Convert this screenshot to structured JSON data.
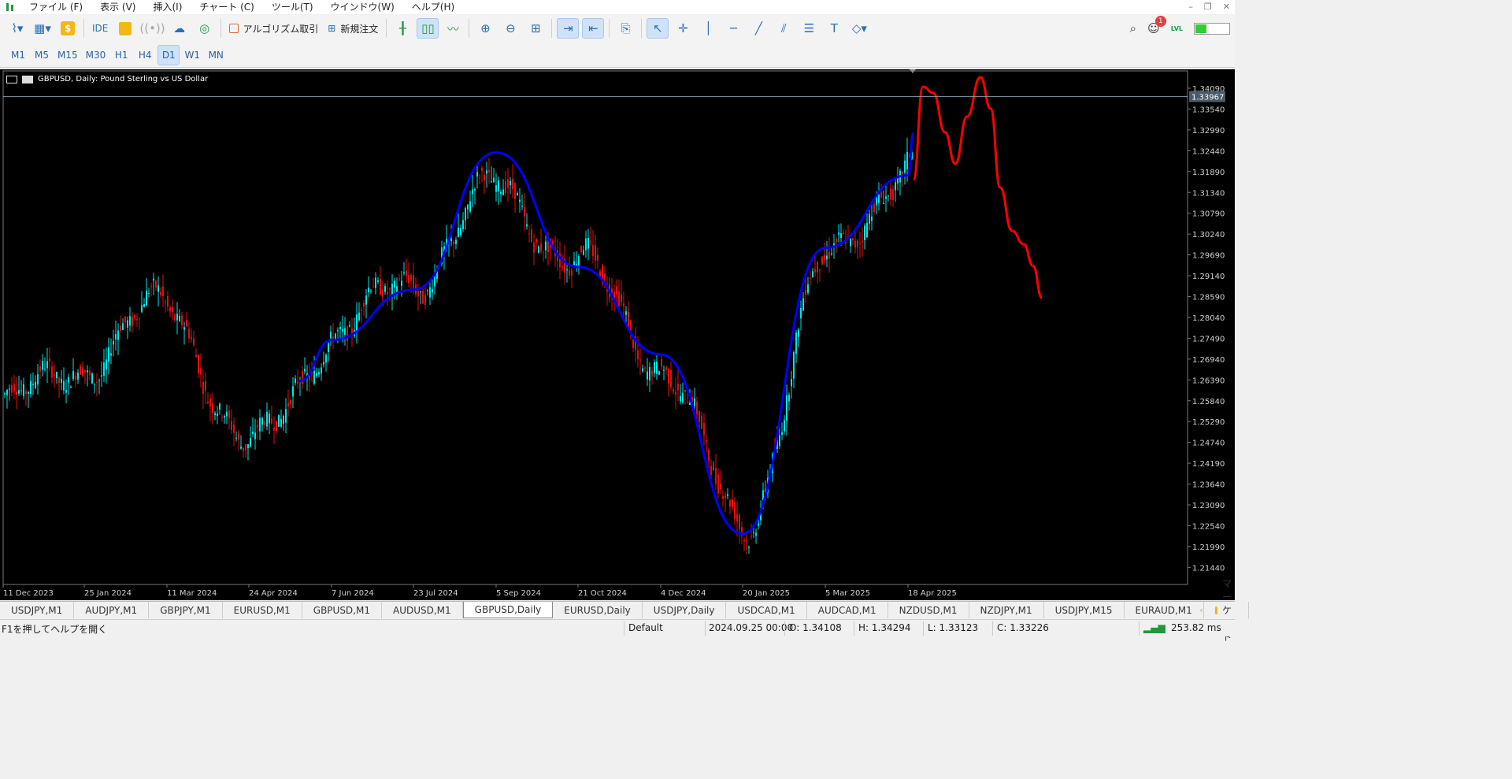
{
  "menu": [
    "ファイル (F)",
    "表示 (V)",
    "挿入(I)",
    "チャート (C)",
    "ツール(T)",
    "ウインドウ(W)",
    "ヘルプ(H)"
  ],
  "toolbar": {
    "ide_label": "IDE",
    "algo_label": "アルゴリズム取引",
    "new_order_label": "新規注文",
    "notifications_count": "1",
    "lvl_label": "LVL"
  },
  "timeframes": [
    "M1",
    "M5",
    "M15",
    "M30",
    "H1",
    "H4",
    "D1",
    "W1",
    "MN"
  ],
  "active_timeframe": "D1",
  "chart": {
    "title": "GBPUSD, Daily:  Pound Sterling vs US Dollar",
    "current_price": "1.33967",
    "price_labels": [
      "1.34090",
      "1.33540",
      "1.32990",
      "1.32440",
      "1.31890",
      "1.31340",
      "1.30790",
      "1.30240",
      "1.29690",
      "1.29140",
      "1.28590",
      "1.28040",
      "1.27490",
      "1.26940",
      "1.26390",
      "1.25840",
      "1.25290",
      "1.24740",
      "1.24190",
      "1.23640",
      "1.23090",
      "1.22540",
      "1.21990",
      "1.21440"
    ],
    "date_labels": [
      "11 Dec 2023",
      "25 Jan 2024",
      "11 Mar 2024",
      "24 Apr 2024",
      "7 Jun 2024",
      "23 Jul 2024",
      "5 Sep 2024",
      "21 Oct 2024",
      "4 Dec 2024",
      "20 Jan 2025",
      "5 Mar 2025",
      "18 Apr 2025"
    ],
    "colors": {
      "bull": "#00e5e5",
      "bear": "#e01010",
      "ma": "#0000ff",
      "forecast": "#ff0000",
      "bg": "#000000"
    }
  },
  "chart_data": {
    "type": "line",
    "title": "GBPUSD, Daily:  Pound Sterling vs US Dollar",
    "ylim": [
      1.2117,
      1.3464
    ],
    "series": [
      {
        "x": [
          "11 Dec 2023",
          "25 Jan 2024",
          "11 Mar 2024",
          "24 Apr 2024",
          "7 Jun 2024",
          "23 Jul 2024",
          "5 Sep 2024",
          "21 Oct 2024",
          "4 Dec 2024",
          "20 Jan 2025",
          "5 Mar 2025",
          "18 Apr 2025"
        ],
        "values": [
          1.2587,
          1.2696,
          1.2855,
          1.2465,
          1.2763,
          1.2921,
          1.3155,
          1.296,
          1.2702,
          1.2261,
          1.2952,
          1.3225
        ]
      },
      {
        "x": [
          "7 Jun 2024",
          "23 Jul 2024",
          "5 Sep 2024",
          "21 Oct 2024",
          "4 Dec 2024",
          "20 Jan 2025",
          "5 Mar 2025",
          "18 Apr 2025"
        ],
        "values": [
          1.2758,
          1.289,
          1.325,
          1.295,
          1.272,
          1.225,
          1.3,
          1.319
        ]
      },
      {
        "x": [
          "18 Apr 2025"
        ],
        "values": [
          1.3397
        ]
      }
    ],
    "grid": false
  },
  "tabs": [
    "USDJPY,M1",
    "AUDJPY,M1",
    "GBPJPY,M1",
    "EURUSD,M1",
    "GBPUSD,M1",
    "AUDUSD,M1",
    "GBPUSD,Daily",
    "EURUSD,Daily",
    "USDJPY,Daily",
    "USDCAD,M1",
    "AUDCAD,M1",
    "NZDUSD,M1",
    "NZDJPY,M1",
    "USDJPY,M15",
    "EURAUD,M1"
  ],
  "active_tab": "GBPUSD,Daily",
  "market_tab": "マーケット",
  "status": {
    "help": "F1を押してヘルプを開く",
    "profile": "Default",
    "datetime": "2024.09.25 00:00",
    "open": "O: 1.34108",
    "high": "H: 1.34294",
    "low": "L: 1.33123",
    "close": "C: 1.33226",
    "ping": "253.82 ms"
  }
}
